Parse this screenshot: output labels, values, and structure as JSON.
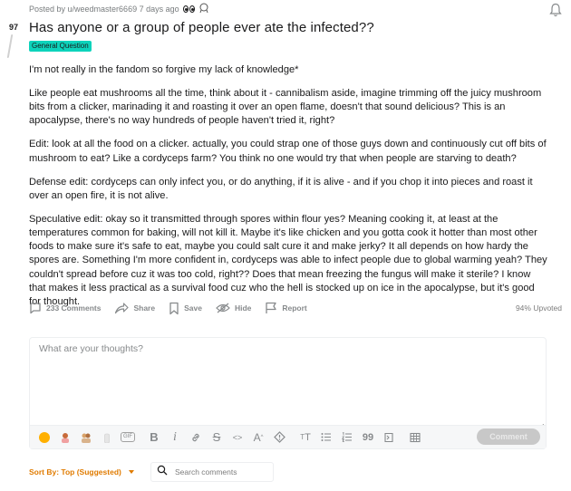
{
  "post": {
    "vote_count": "97",
    "meta_text": "Posted by u/weedmaster6669 7 days ago",
    "title": "Has anyone or a group of people ever ate the infected??",
    "flair": "General Question",
    "paragraphs": [
      "I'm not really in the fandom so forgive my lack of knowledge*",
      "Like people eat mushrooms all the time, think about it - cannibalism aside, imagine trimming off the juicy mushroom bits from a clicker, marinading it and roasting it over an open flame, doesn't that sound delicious? This is an apocalypse, there's no way hundreds of people haven't tried it, right?",
      "Edit: look at all the food on a clicker. actually, you could strap one of those guys down and continuously cut off bits of mushroom to eat? Like a cordyceps farm? You think no one would try that when people are starving to death?",
      "Defense edit: cordyceps can only infect you, or do anything, if it is alive - and if you chop it into pieces and roast it over an open fire, it is not alive.",
      "Speculative edit: okay so it transmitted through spores within flour yes? Meaning cooking it, at least at the temperatures common for baking, will not kill it. Maybe it's like chicken and you gotta cook it hotter than most other foods to make sure it's safe to eat, maybe you could salt cure it and make jerky? It all depends on how hardy the spores are. Something I'm more confident in, cordyceps was able to infect people due to global warming yeah? They couldn't spread before cuz it was too cold, right?? Does that mean freezing the fungus will make it sterile? I know that makes it less practical as a survival food cuz who the hell is stocked up on ice in the apocalypse, but it's good for thought."
    ],
    "upvoted": "94% Upvoted"
  },
  "actions": {
    "comments": "233 Comments",
    "share": "Share",
    "save": "Save",
    "hide": "Hide",
    "report": "Report"
  },
  "editor": {
    "placeholder": "What are your thoughts?",
    "gif_label": "GIF",
    "bold": "B",
    "italic": "i",
    "strike": "S",
    "code": "<>",
    "superscript": "A",
    "heading": "T",
    "quote": "99",
    "comment_button": "Comment"
  },
  "sort": {
    "label": "Sort By: Top (Suggested)",
    "search_placeholder": "Search comments"
  },
  "colors": {
    "flair": "#0dd3bb",
    "sort_accent": "#e07b00",
    "muted": "#878a8c"
  },
  "icons": [
    "bell-icon",
    "comment-icon",
    "share-icon",
    "save-icon",
    "hide-icon",
    "report-icon",
    "emoji-icon",
    "gif-icon",
    "bold-icon",
    "italic-icon",
    "link-icon",
    "strikethrough-icon",
    "code-icon",
    "superscript-icon",
    "spoiler-icon",
    "heading-icon",
    "bullet-list-icon",
    "numbered-list-icon",
    "quote-icon",
    "code-block-icon",
    "table-icon",
    "search-icon"
  ]
}
